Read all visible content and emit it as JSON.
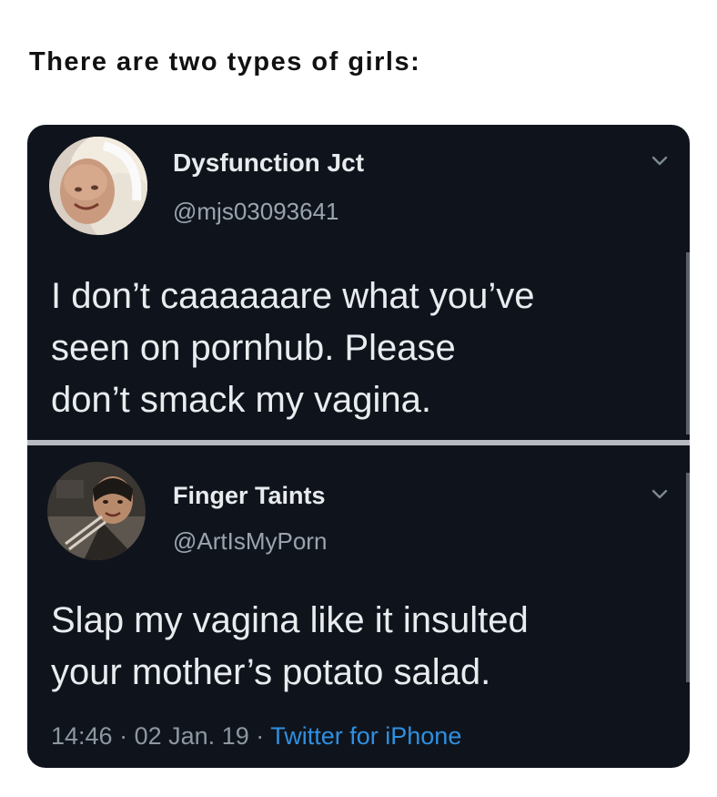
{
  "caption": "There are two types of girls:",
  "tweets": [
    {
      "display_name": "Dysfunction Jct",
      "handle": "@mjs03093641",
      "text_lines": [
        "I don’t caaaaaare what you’ve",
        "seen on pornhub.  Please",
        "don’t smack my vagina."
      ],
      "menu_icon": "chevron-down-icon"
    },
    {
      "display_name": "Finger Taints",
      "handle": "@ArtIsMyPorn",
      "text_lines": [
        "Slap my vagina like it insulted",
        "your mother’s potato salad."
      ],
      "menu_icon": "chevron-down-icon",
      "time": "14:46",
      "separator": "·",
      "date": "02 Jan. 19",
      "source": "Twitter for iPhone"
    }
  ],
  "colors": {
    "background": "#0f141c",
    "text": "#e9ecef",
    "muted": "#8d97a1",
    "link": "#2f8fe0"
  }
}
